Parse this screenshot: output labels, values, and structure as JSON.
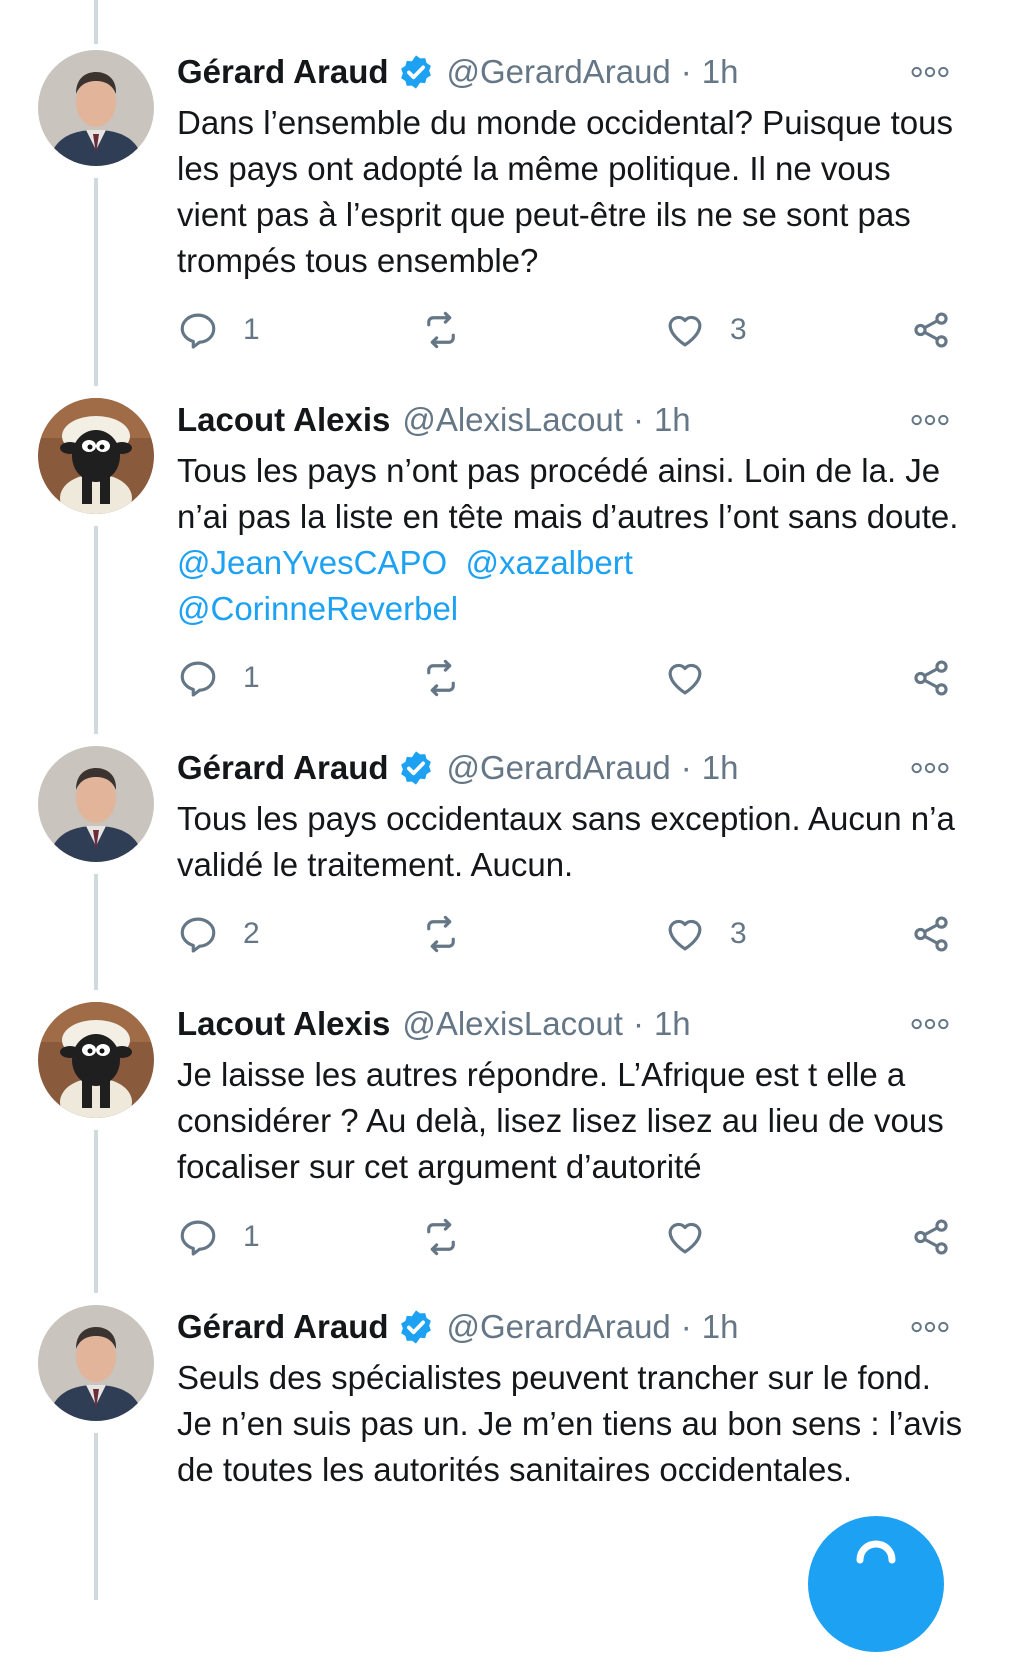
{
  "accent_color": "#1da1f2",
  "tweets": [
    {
      "name": "Gérard Araud",
      "verified": true,
      "handle": "@GerardAraud",
      "separator": "·",
      "time": "1h",
      "text": "Dans l’ensemble du monde occidental? Puisque tous les pays ont adopté la même politique. Il ne vous vient pas à l’esprit que peut-être ils ne se sont pas trompés tous ensemble?",
      "mentions": [],
      "replies": "1",
      "retweets": "",
      "likes": "3",
      "avatar": "man-in-suit"
    },
    {
      "name": "Lacout Alexis",
      "verified": false,
      "handle": "@AlexisLacout",
      "separator": "·",
      "time": "1h",
      "text": "Tous les pays n’ont pas procédé ainsi. Loin de la. Je n’ai pas la liste en tête mais d’autres l’ont sans doute.",
      "mentions": [
        "@JeanYvesCAPO",
        "@xazalbert",
        "@CorinneReverbel"
      ],
      "replies": "1",
      "retweets": "",
      "likes": "",
      "avatar": "sheep-plush"
    },
    {
      "name": "Gérard Araud",
      "verified": true,
      "handle": "@GerardAraud",
      "separator": "·",
      "time": "1h",
      "text": "Tous les pays occidentaux sans exception. Aucun n’a validé le traitement. Aucun.",
      "mentions": [],
      "replies": "2",
      "retweets": "",
      "likes": "3",
      "avatar": "man-in-suit"
    },
    {
      "name": "Lacout Alexis",
      "verified": false,
      "handle": "@AlexisLacout",
      "separator": "·",
      "time": "1h",
      "text": "Je laisse les autres répondre. L’Afrique est t elle a considérer ? Au delà, lisez lisez lisez au lieu de vous focaliser sur cet argument d’autorité",
      "mentions": [],
      "replies": "1",
      "retweets": "",
      "likes": "",
      "avatar": "sheep-plush"
    },
    {
      "name": "Gérard Araud",
      "verified": true,
      "handle": "@GerardAraud",
      "separator": "·",
      "time": "1h",
      "text": "Seuls des spécialistes peuvent trancher sur le fond. Je n’en suis pas un. Je m’en tiens au bon sens : l’avis de toutes les autorités sanitaires occidentales.",
      "mentions": [],
      "replies": "",
      "retweets": "",
      "likes": "",
      "avatar": "man-in-suit"
    }
  ],
  "icons": {
    "reply": "reply-icon",
    "retweet": "retweet-icon",
    "like": "heart-icon",
    "share": "share-icon",
    "more": "more-options-icon",
    "verified": "verified-badge-icon",
    "compose": "compose-fab"
  }
}
